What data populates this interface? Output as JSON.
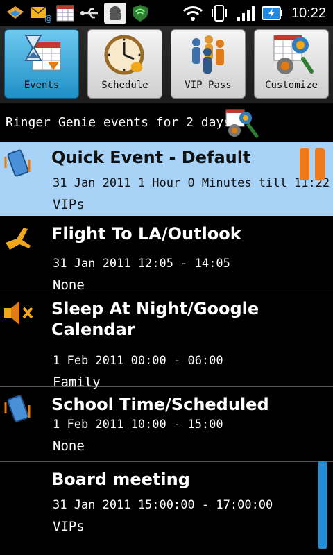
{
  "status_bar": {
    "icons": [
      "app-icon",
      "email-icon",
      "calendar-icon",
      "usb-icon",
      "android-icon",
      "shield-icon",
      "wifi-icon",
      "vibrate-icon",
      "signal-icon",
      "battery-icon"
    ],
    "time": "10:22"
  },
  "tabs": [
    {
      "label": "Events",
      "icon": "hourglass-calendar-icon",
      "active": true
    },
    {
      "label": "Schedule",
      "icon": "clock-icon",
      "active": false
    },
    {
      "label": "VIP Pass",
      "icon": "people-icon",
      "active": false
    },
    {
      "label": "Customize",
      "icon": "gear-calendar-icon",
      "active": false
    }
  ],
  "header": {
    "text": "Ringer Genie events for 2 days:",
    "icon": "calendar-settings-icon"
  },
  "events": [
    {
      "title": "Quick Event - Default",
      "time": "31 Jan 2011 1 Hour 0 Minutes till 11:22",
      "who": "VIPs",
      "icon": "vibrate-phone-icon",
      "selected": true
    },
    {
      "title": "Flight To LA/Outlook",
      "time": "31 Jan 2011 12:05 - 14:05",
      "who": "None",
      "icon": "airplane-icon",
      "selected": false
    },
    {
      "title_line1": "Sleep At Night/Google",
      "title_line2": "Calendar",
      "time": "1 Feb 2011 00:00 - 06:00",
      "who": "Family",
      "icon": "mute-speaker-icon",
      "selected": false
    },
    {
      "title": "School Time/Scheduled",
      "time": "1 Feb 2011 10:00 - 15:00",
      "who": "None",
      "icon": "vibrate-phone-icon",
      "selected": false
    },
    {
      "title": "Board meeting",
      "time": "31 Jan 2011 15:00:00 - 17:00:00",
      "who": "VIPs",
      "icon": "",
      "selected": false
    }
  ],
  "colors": {
    "accent": "#1f8fc6",
    "selected_row": "#a9d3f6",
    "pause": "#f07a1a",
    "scrollbar": "#1e8fd8"
  }
}
